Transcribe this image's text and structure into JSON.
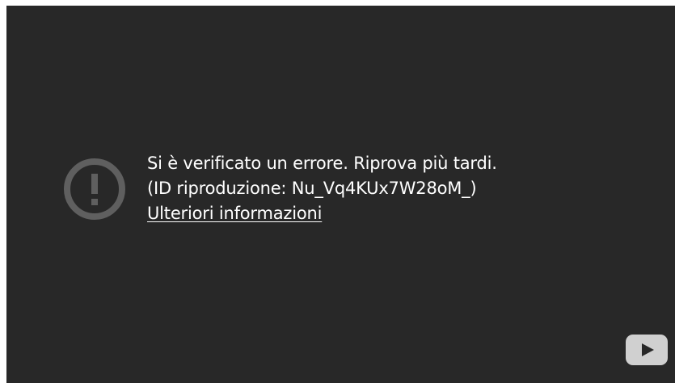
{
  "player": {
    "background": "#282828",
    "error": {
      "message": "Si è verificato un errore. Riprova più tardi.",
      "playback_id": "(ID riproduzione: Nu_Vq4KUx7W28oM_)",
      "more_info_link": "Ulteriori informazioni"
    },
    "icons": {
      "alert": "exclamation-circle-icon",
      "logo": "youtube-play-icon"
    },
    "colors": {
      "text": "#ffffff",
      "icon_gray": "#5f5f5f",
      "logo_gray": "#d0d0d0"
    }
  }
}
